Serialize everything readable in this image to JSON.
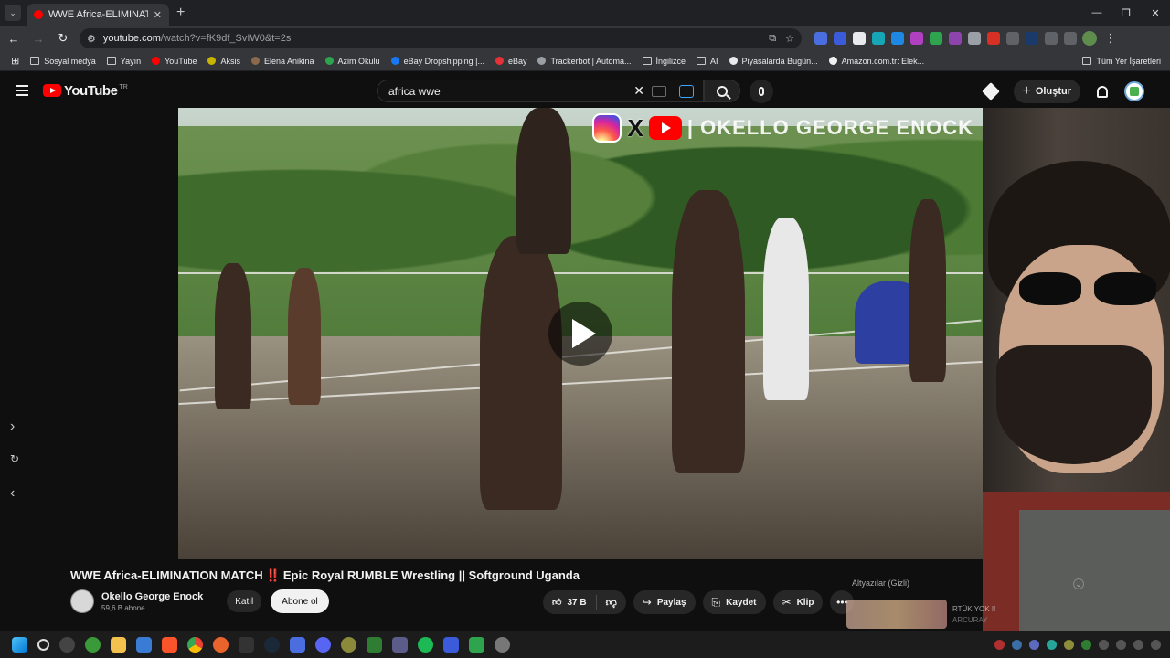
{
  "browser": {
    "tab": {
      "title": "WWE Africa-ELIMINATION"
    },
    "url": {
      "host": "youtube.com",
      "rest": "/watch?v=fK9df_SvIW0&t=2s"
    },
    "bookmarks": [
      {
        "label": "Sosyal medya",
        "kind": "folder"
      },
      {
        "label": "Yayın",
        "kind": "folder"
      },
      {
        "label": "YouTube",
        "kind": "site",
        "color": "#ff0000"
      },
      {
        "label": "Aksis",
        "kind": "site",
        "color": "#c8b400"
      },
      {
        "label": "Elena Anikina",
        "kind": "site",
        "color": "#8a6a4a"
      },
      {
        "label": "Azim Okulu",
        "kind": "site",
        "color": "#2ea44f"
      },
      {
        "label": "eBay Dropshipping |...",
        "kind": "site",
        "color": "#1877f2"
      },
      {
        "label": "eBay",
        "kind": "site",
        "color": "#e53238"
      },
      {
        "label": "Trackerbot | Automa...",
        "kind": "site",
        "color": "#9aa0a6"
      },
      {
        "label": "İngilizce",
        "kind": "folder"
      },
      {
        "label": "AI",
        "kind": "folder"
      },
      {
        "label": "Piyasalarda Bugün...",
        "kind": "site",
        "color": "#e8eaed"
      },
      {
        "label": "Amazon.com.tr: Elek...",
        "kind": "site",
        "color": "#f0f0f0"
      }
    ],
    "bookmarks_right": "Tüm Yer İşaretleri"
  },
  "youtube": {
    "logo_text": "YouTube",
    "country_code": "TR",
    "search_value": "africa wwe",
    "create_label": "Oluştur"
  },
  "video": {
    "title_part1": "WWE Africa-ELIMINATION MATCH",
    "title_bang": "‼️",
    "title_part2": "Epic Royal RUMBLE Wrestling || Softground Uganda",
    "overlay_channel_text": "| OKELLO GEORGE ENOCK",
    "overlay_small_label": "2 X"
  },
  "channel": {
    "name": "Okello George Enock",
    "subscribers": "59,6 B abone",
    "join_label": "Katıl",
    "subscribe_label": "Abone ol"
  },
  "actions": {
    "like_count": "37 B",
    "share_label": "Paylaş",
    "save_label": "Kaydet",
    "clip_label": "Klip"
  },
  "side_panel": {
    "captions_label": "Altyazılar (Gizli)",
    "suggestion_title": "RTÜK YOK !!",
    "suggestion_channel": "ARCURAY"
  },
  "icons": {
    "tab_favicon": "youtube-icon",
    "create": "plus-icon",
    "notifications": "bell-icon"
  },
  "colors": {
    "accent_red": "#ff0000",
    "subscribe_bg": "#f1f1f1",
    "page_bg": "#0f0f0f"
  }
}
